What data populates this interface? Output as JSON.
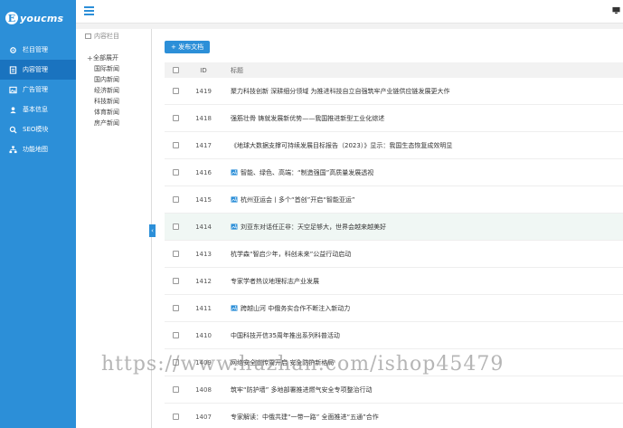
{
  "brand": {
    "badge": "E",
    "name": "youcms"
  },
  "sidebar": {
    "items": [
      {
        "label": "栏目管理",
        "icon": "gear-icon",
        "active": false
      },
      {
        "label": "内容管理",
        "icon": "document-icon",
        "active": true
      },
      {
        "label": "广告管理",
        "icon": "image-icon",
        "active": false
      },
      {
        "label": "基本信息",
        "icon": "user-icon",
        "active": false
      },
      {
        "label": "SEO模块",
        "icon": "search-icon",
        "active": false
      },
      {
        "label": "功能地图",
        "icon": "sitemap-icon",
        "active": false
      }
    ]
  },
  "category_panel": {
    "title": "内容栏目",
    "root": "全部展开",
    "children": [
      "国际新闻",
      "国内新闻",
      "经济新闻",
      "科技新闻",
      "体育新闻",
      "房产新闻"
    ]
  },
  "toolbar": {
    "add_label": "+ 发布文档"
  },
  "table": {
    "headers": {
      "id": "ID",
      "title": "标题"
    },
    "rows": [
      {
        "id": "1419",
        "title": "聚力科技创新 深耕细分领域 为推进科技自立自强筑牢产业链供应链发展更大作",
        "has_image": false
      },
      {
        "id": "1418",
        "title": "强筋壮骨 铸就发展新优势——我国推进新型工业化综述",
        "has_image": false
      },
      {
        "id": "1417",
        "title": "《地球大数据支撑可持续发展目标报告（2023）》显示：我国生态恢复成效明显",
        "has_image": false
      },
      {
        "id": "1416",
        "title": "智能、绿色、高端：“制造强国”高质量发展透视",
        "has_image": true
      },
      {
        "id": "1415",
        "title": "杭州亚运会丨多个“首创”开启“智能亚运”",
        "has_image": true
      },
      {
        "id": "1414",
        "title": "刘亚东对话任正非：天空足够大，世界会越来越美好",
        "has_image": true
      },
      {
        "id": "1413",
        "title": "杭学森“智启少年，科创未来”公益行动启动",
        "has_image": false
      },
      {
        "id": "1412",
        "title": "专家学者热议地理标志产业发展",
        "has_image": false
      },
      {
        "id": "1411",
        "title": "跨越山河 中俄务实合作不断注入新动力",
        "has_image": true
      },
      {
        "id": "1410",
        "title": "中国科技开信35周年推出系列科普活动",
        "has_image": false
      },
      {
        "id": "1409",
        "title": "网络安全宣传周开启 安全防护新格局",
        "has_image": false
      },
      {
        "id": "1408",
        "title": "筑牢“防护墙” 多地部署推进燃气安全专项整治行动",
        "has_image": false
      },
      {
        "id": "1407",
        "title": "专家解读：中俄共建“一带一路” 全面推进“五通”合作",
        "has_image": false
      }
    ]
  },
  "watermark": "https://www.huzhan.com/ishop45479",
  "colors": {
    "accent": "#2c8fd8",
    "sidebar_active": "#1a73bf",
    "row_highlight": "#f0f7f4"
  }
}
